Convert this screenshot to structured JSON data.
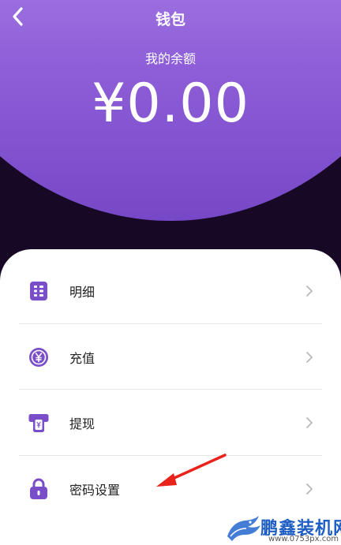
{
  "header": {
    "title": "钱包",
    "balance_label": "我的余额",
    "balance_amount": "¥0.00",
    "accent_color": "#8e5fd8"
  },
  "menu": {
    "items": [
      {
        "label": "明细",
        "icon": "list-grid-icon"
      },
      {
        "label": "充值",
        "icon": "yen-coin-icon"
      },
      {
        "label": "提现",
        "icon": "withdraw-card-icon"
      },
      {
        "label": "密码设置",
        "icon": "lock-icon"
      }
    ],
    "icon_color": "#7a4ec8"
  },
  "watermark": {
    "title": "鹏鑫装机网",
    "url": "www.0753px.com"
  }
}
